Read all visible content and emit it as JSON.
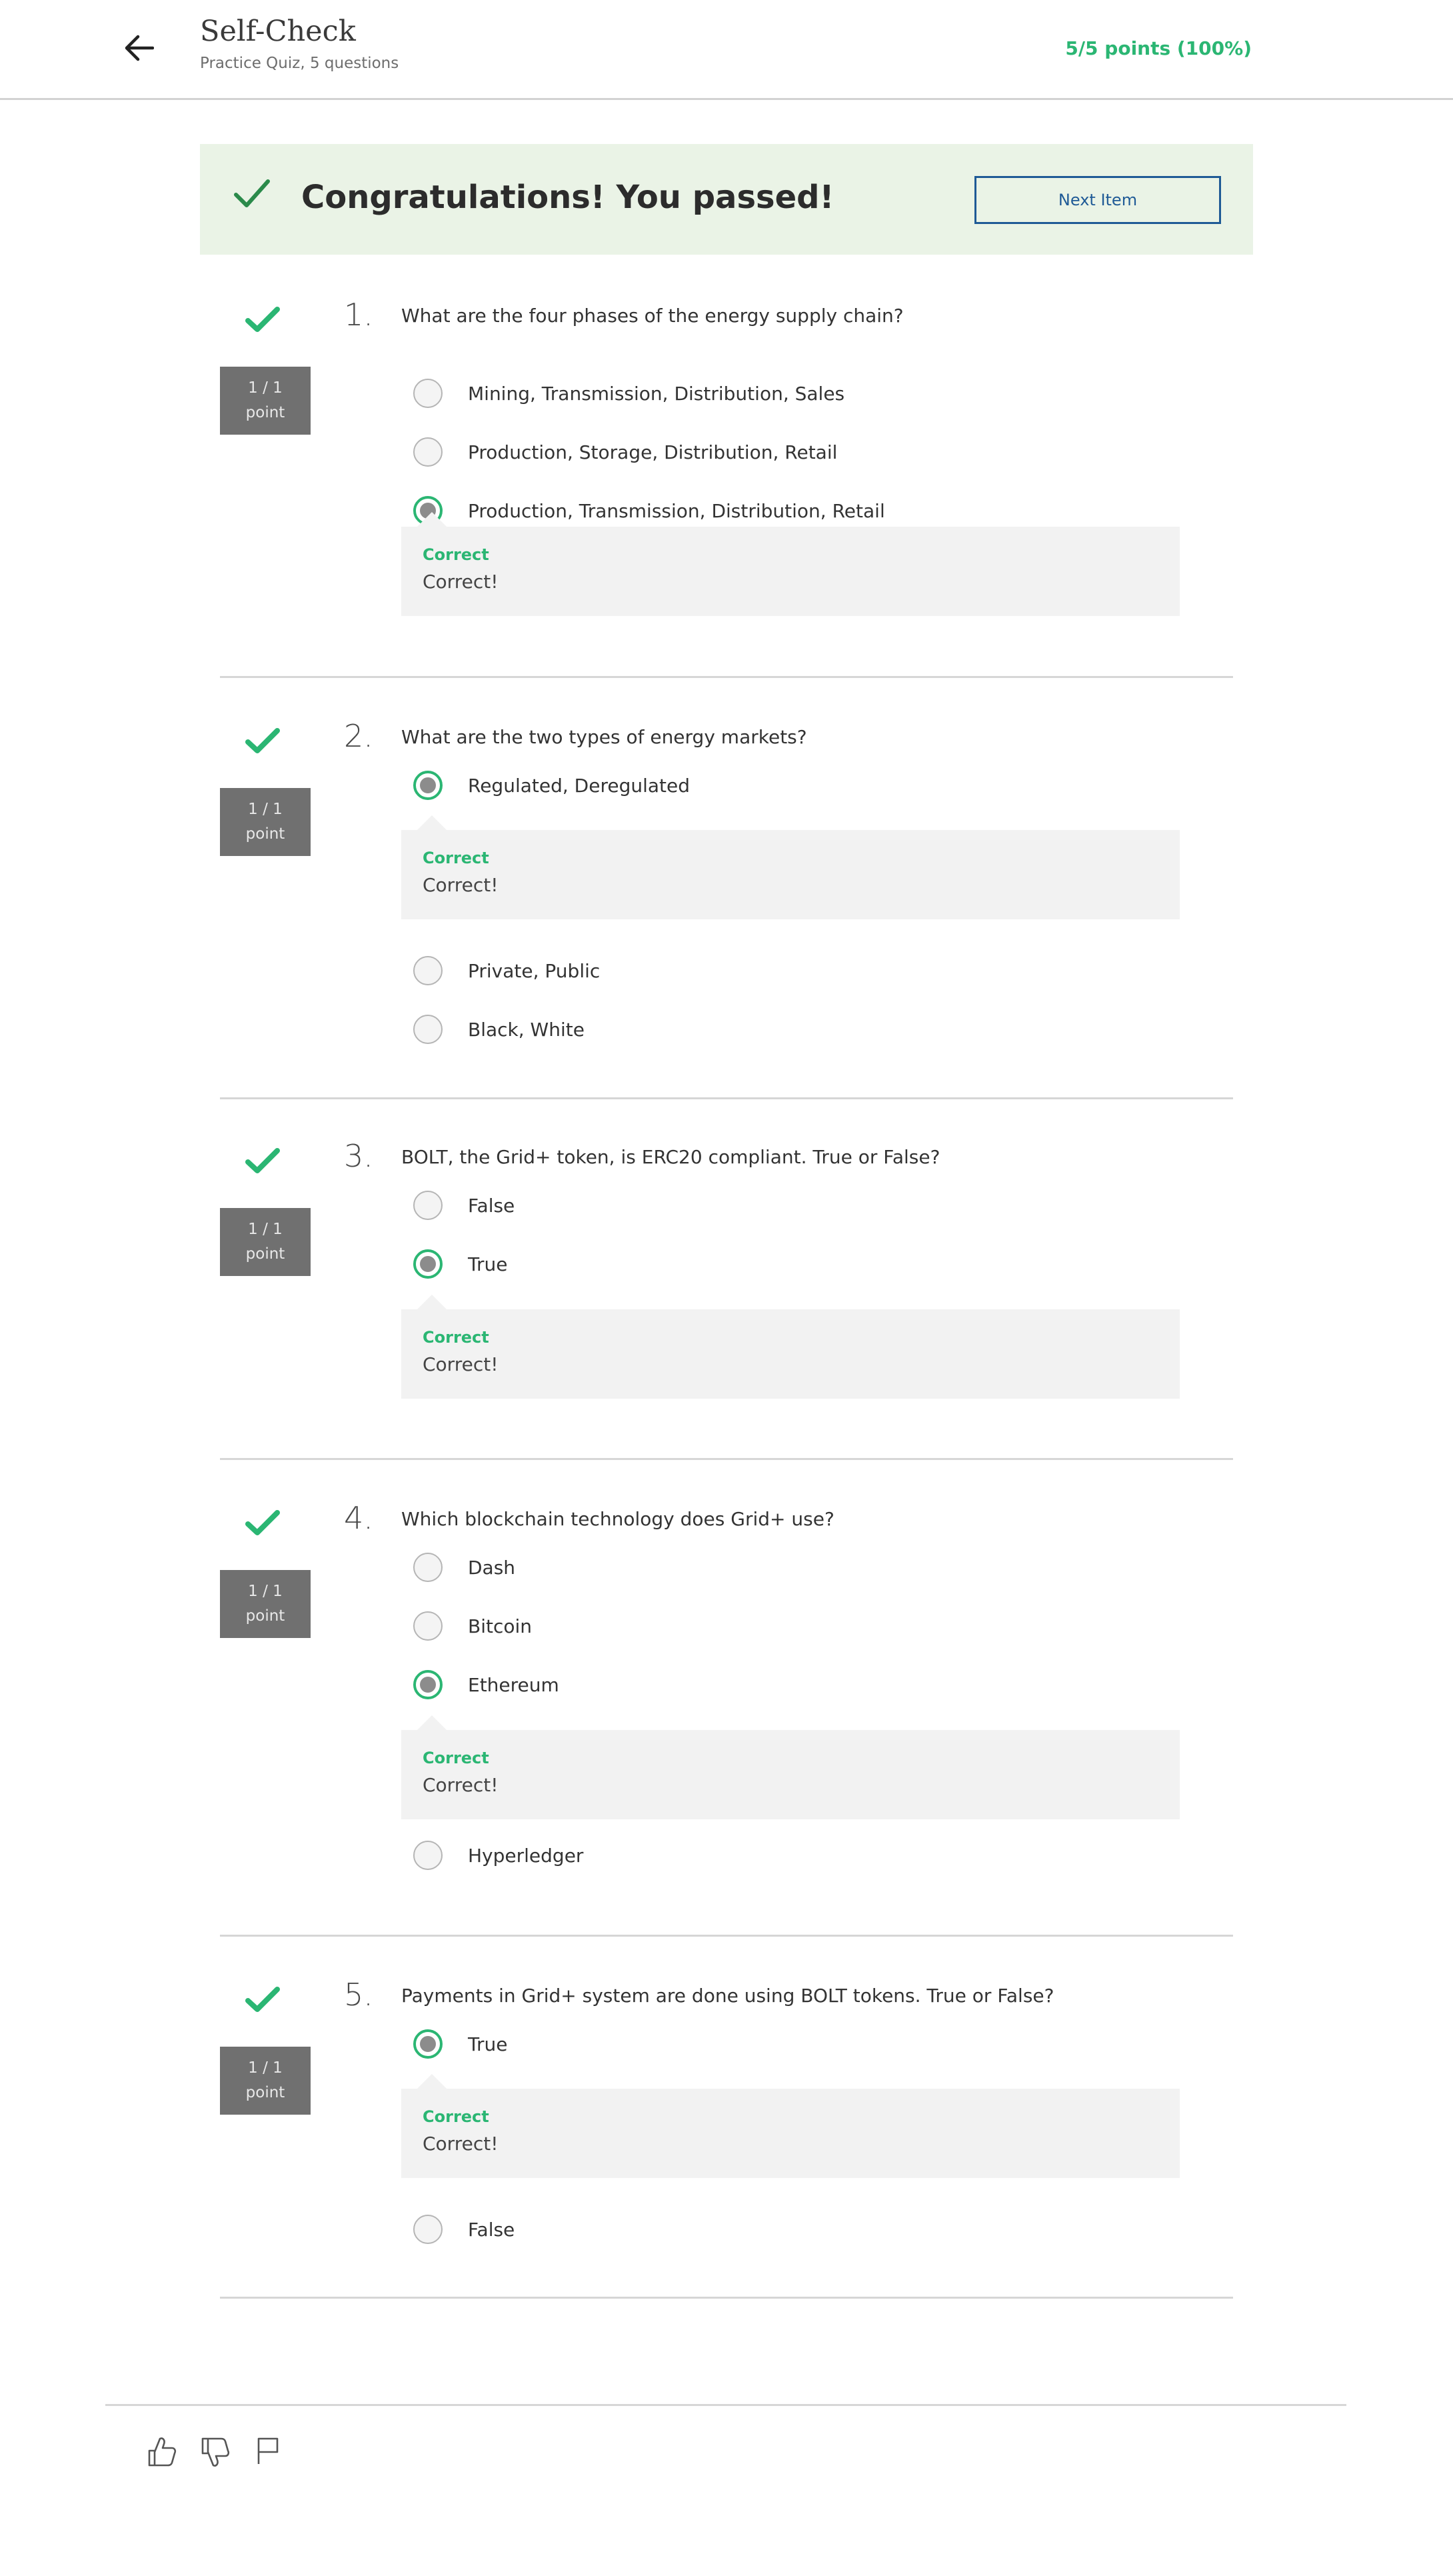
{
  "header": {
    "title": "Self-Check",
    "subtitle": "Practice Quiz, 5 questions",
    "score": "5/5 points (100%)"
  },
  "banner": {
    "message": "Congratulations! You passed!",
    "next_label": "Next Item"
  },
  "colors": {
    "accent_green": "#2bb673",
    "link_blue": "#1f5a96",
    "points_gray": "#707070"
  },
  "questions": [
    {
      "number": "1.",
      "text": "What are the four phases of the energy supply chain?",
      "points": "1 / 1",
      "points_unit": "point",
      "options": [
        "Mining, Transmission, Distribution, Sales",
        "Production, Storage, Distribution, Retail",
        "Production, Transmission, Distribution, Retail"
      ],
      "selected": 2,
      "feedback_title": "Correct",
      "feedback_text": "Correct!"
    },
    {
      "number": "2.",
      "text": "What are the two types of energy markets?",
      "points": "1 / 1",
      "points_unit": "point",
      "options": [
        "Regulated, Deregulated",
        "Private, Public",
        "Black, White"
      ],
      "selected": 0,
      "feedback_title": "Correct",
      "feedback_text": "Correct!"
    },
    {
      "number": "3.",
      "text": "BOLT, the Grid+ token, is ERC20 compliant. True or False?",
      "points": "1 / 1",
      "points_unit": "point",
      "options": [
        "False",
        "True"
      ],
      "selected": 1,
      "feedback_title": "Correct",
      "feedback_text": "Correct!"
    },
    {
      "number": "4.",
      "text": "Which blockchain technology does Grid+ use?",
      "points": "1 / 1",
      "points_unit": "point",
      "options": [
        "Dash",
        "Bitcoin",
        "Ethereum",
        "Hyperledger"
      ],
      "selected": 2,
      "feedback_title": "Correct",
      "feedback_text": "Correct!"
    },
    {
      "number": "5.",
      "text": "Payments in Grid+ system are done using BOLT tokens. True or False?",
      "points": "1 / 1",
      "points_unit": "point",
      "options": [
        "True",
        "False"
      ],
      "selected": 0,
      "feedback_title": "Correct",
      "feedback_text": "Correct!"
    }
  ],
  "footer": {
    "icons": [
      "thumbs-up-icon",
      "thumbs-down-icon",
      "flag-icon"
    ]
  }
}
